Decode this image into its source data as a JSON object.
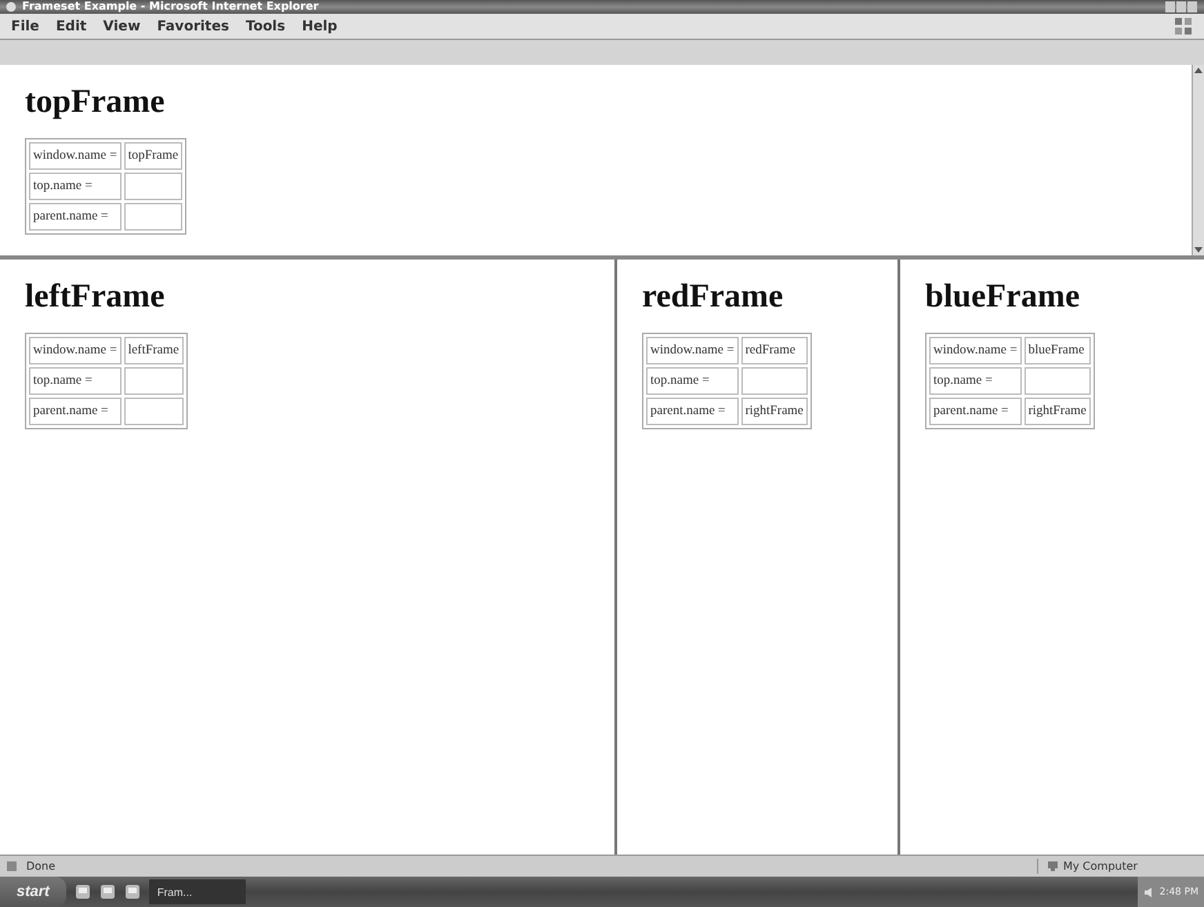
{
  "window": {
    "title": "Frameset Example - Microsoft Internet Explorer"
  },
  "menu": [
    "File",
    "Edit",
    "View",
    "Favorites",
    "Tools",
    "Help"
  ],
  "top_frame": {
    "heading": "topFrame",
    "rows": [
      {
        "label": "window.name =",
        "value": "topFrame"
      },
      {
        "label": "top.name =",
        "value": ""
      },
      {
        "label": "parent.name =",
        "value": ""
      }
    ]
  },
  "bottom_frames": [
    {
      "heading": "leftFrame",
      "rows": [
        {
          "label": "window.name =",
          "value": "leftFrame"
        },
        {
          "label": "top.name =",
          "value": ""
        },
        {
          "label": "parent.name =",
          "value": ""
        }
      ]
    },
    {
      "heading": "redFrame",
      "rows": [
        {
          "label": "window.name =",
          "value": "redFrame"
        },
        {
          "label": "top.name =",
          "value": ""
        },
        {
          "label": "parent.name =",
          "value": "rightFrame"
        }
      ]
    },
    {
      "heading": "blueFrame",
      "rows": [
        {
          "label": "window.name =",
          "value": "blueFrame"
        },
        {
          "label": "top.name =",
          "value": ""
        },
        {
          "label": "parent.name =",
          "value": "rightFrame"
        }
      ]
    }
  ],
  "status_bar": {
    "text": "Done",
    "zone": "My Computer"
  },
  "taskbar": {
    "start": "start",
    "tasks": [
      "Fram..."
    ],
    "clock": "2:48 PM"
  }
}
